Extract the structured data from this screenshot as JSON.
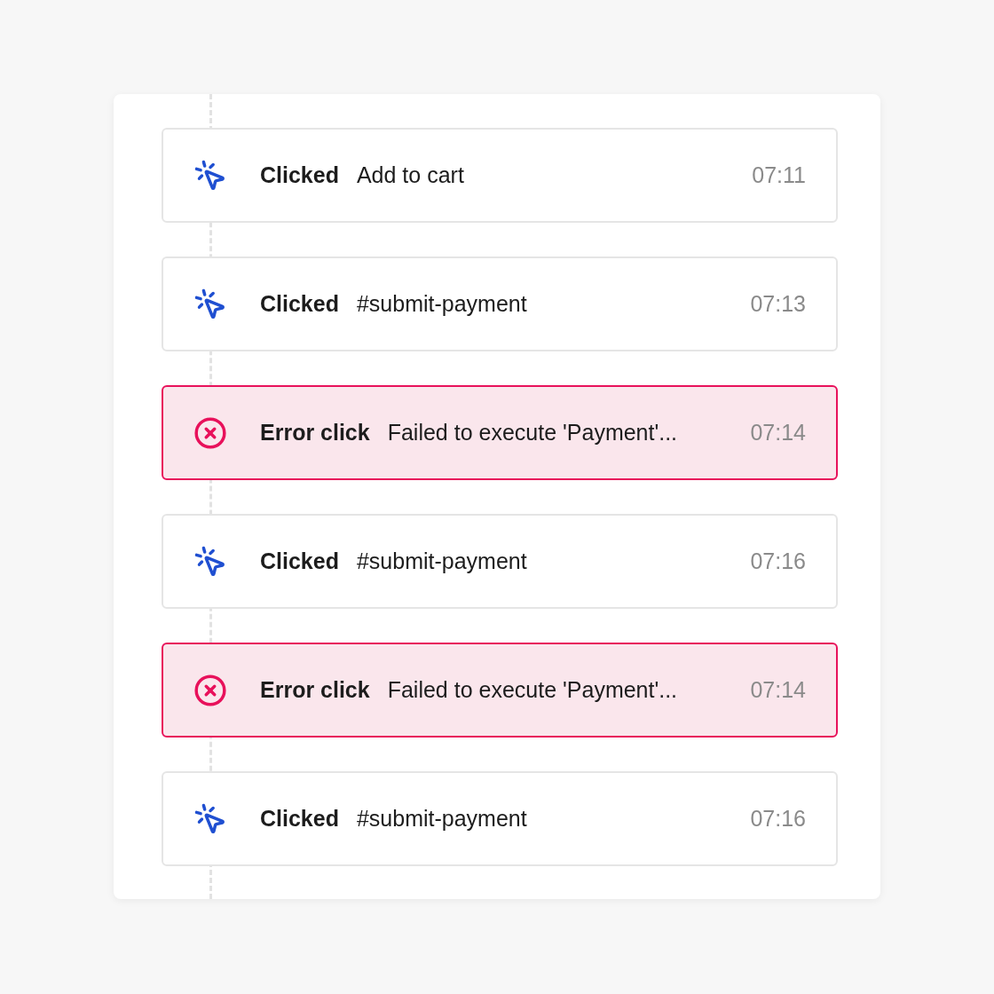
{
  "events": [
    {
      "kind": "click",
      "action": "Clicked",
      "target": "Add to cart",
      "time": "07:11"
    },
    {
      "kind": "click",
      "action": "Clicked",
      "target": "#submit-payment",
      "time": "07:13"
    },
    {
      "kind": "error",
      "action": "Error click",
      "target": "Failed to execute 'Payment'...",
      "time": "07:14"
    },
    {
      "kind": "click",
      "action": "Clicked",
      "target": "#submit-payment",
      "time": "07:16"
    },
    {
      "kind": "error",
      "action": "Error click",
      "target": "Failed to execute 'Payment'...",
      "time": "07:14"
    },
    {
      "kind": "click",
      "action": "Clicked",
      "target": "#submit-payment",
      "time": "07:16"
    }
  ]
}
